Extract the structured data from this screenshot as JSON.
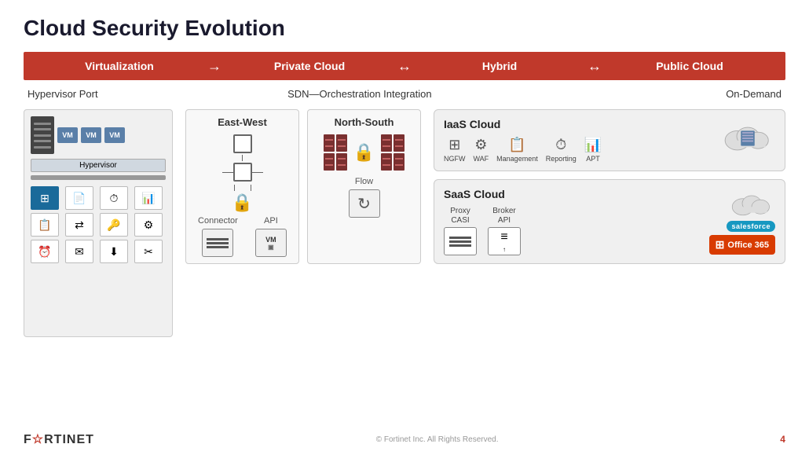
{
  "title": "Cloud Security Evolution",
  "banner": {
    "item1": "Virtualization",
    "arrow1": "→",
    "item2": "Private Cloud",
    "arrow2": "↔",
    "item3": "Hybrid",
    "arrow3": "↔",
    "item4": "Public Cloud"
  },
  "sublabels": {
    "left": "Hypervisor Port",
    "mid": "SDN—Orchestration Integration",
    "right": "On-Demand"
  },
  "left_panel": {
    "vm_labels": [
      "VM",
      "VM",
      "VM"
    ],
    "hypervisor_label": "Hypervisor"
  },
  "mid_panel": {
    "ew_title": "East-West",
    "ns_title": "North-South",
    "connector_label": "Connector",
    "api_label": "API",
    "flow_label": "Flow"
  },
  "right_panel": {
    "iaas_title": "IaaS Cloud",
    "saas_title": "SaaS Cloud",
    "iaas_icons": [
      {
        "label": "NGFW"
      },
      {
        "label": "WAF"
      },
      {
        "label": "Management"
      },
      {
        "label": "Reporting"
      },
      {
        "label": "APT"
      }
    ],
    "saas_items": [
      {
        "label": "Proxy\nCASI"
      },
      {
        "label": "Broker\nAPI"
      }
    ],
    "salesforce_label": "salesforce",
    "office365_label": "Office 365"
  },
  "footer": {
    "logo": "F☆RTINET",
    "copyright": "© Fortinet Inc. All Rights Reserved.",
    "page": "4"
  }
}
